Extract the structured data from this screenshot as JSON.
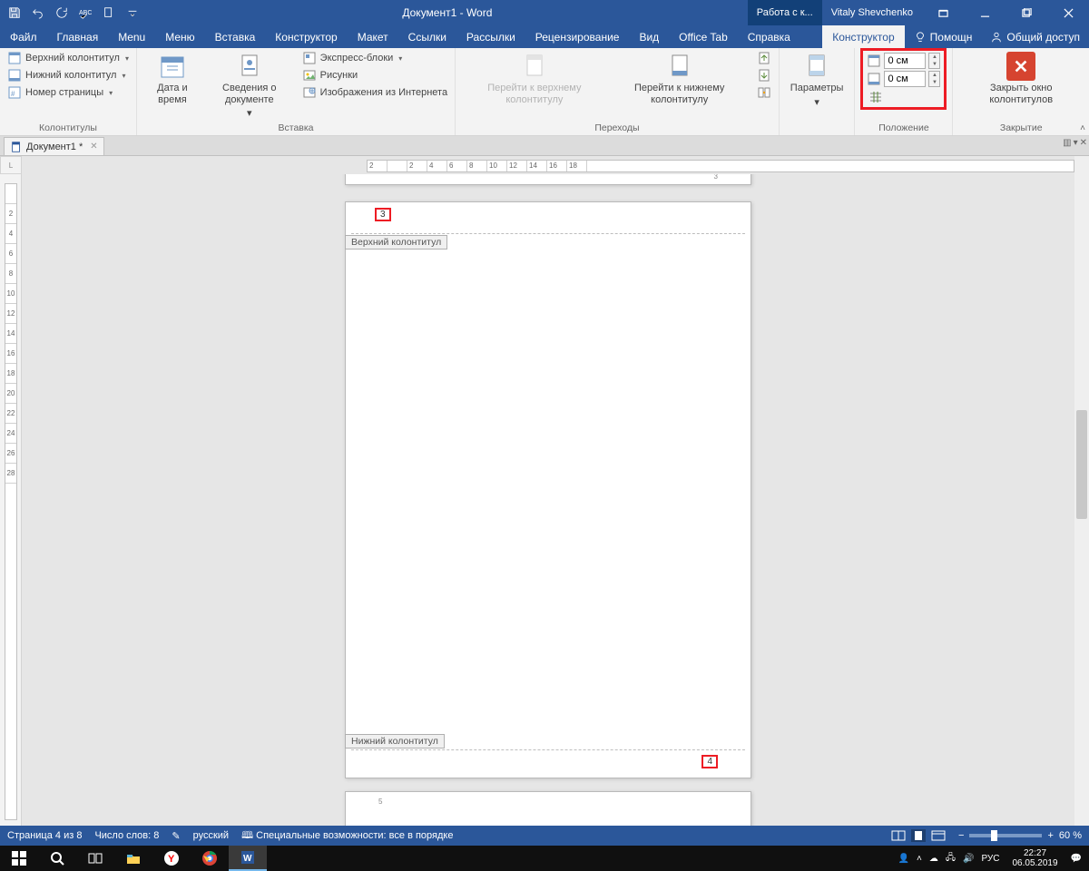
{
  "title": "Документ1  -  Word",
  "tool_context": "Работа с к...",
  "user": "Vitaly Shevchenko",
  "tabs": [
    "Файл",
    "Главная",
    "Menu",
    "Меню",
    "Вставка",
    "Конструктор",
    "Макет",
    "Ссылки",
    "Рассылки",
    "Рецензирование",
    "Вид",
    "Office Tab",
    "Справка"
  ],
  "active_tab": "Конструктор",
  "help_label": "Помощн",
  "share_label": "Общий доступ",
  "ribbon": {
    "g1": {
      "label": "Колонтитулы",
      "items": [
        "Верхний колонтитул",
        "Нижний колонтитул",
        "Номер страницы"
      ]
    },
    "g2": {
      "label": "Вставка",
      "date": "Дата и время",
      "info": "Сведения о документе",
      "quick": "Экспресс-блоки",
      "pics": "Рисунки",
      "online": "Изображения из Интернета"
    },
    "g3": {
      "label": "Переходы",
      "top": "Перейти к верхнему колонтитулу",
      "bottom": "Перейти к нижнему колонтитулу"
    },
    "g4": {
      "label": "",
      "params": "Параметры"
    },
    "g5": {
      "label": "Положение",
      "val1": "0 см",
      "val2": "0 см"
    },
    "g6": {
      "label": "Закрытие",
      "close": "Закрыть окно колонтитулов"
    }
  },
  "doctab": {
    "name": "Документ1 *"
  },
  "ruler_h": [
    "2",
    "",
    "2",
    "4",
    "6",
    "8",
    "10",
    "12",
    "14",
    "16",
    "18"
  ],
  "ruler_h_leading": "2",
  "ruler_v": [
    "",
    "2",
    "4",
    "6",
    "8",
    "10",
    "12",
    "14",
    "16",
    "18",
    "20",
    "22",
    "24",
    "26",
    "28"
  ],
  "page": {
    "header_tag": "Верхний колонтитул",
    "footer_tag": "Нижний колонтитул",
    "prev_num": "3",
    "this_num_top": "3",
    "this_num_bottom": "4",
    "next_num": "5"
  },
  "status": {
    "page": "Страница 4 из 8",
    "words": "Число слов: 8",
    "proof_icon": "✎",
    "lang": "русский",
    "a11y": "Специальные возможности: все в порядке",
    "zoom": "60 %"
  },
  "tray": {
    "lang": "РУС",
    "time": "22:27",
    "date": "06.05.2019"
  }
}
